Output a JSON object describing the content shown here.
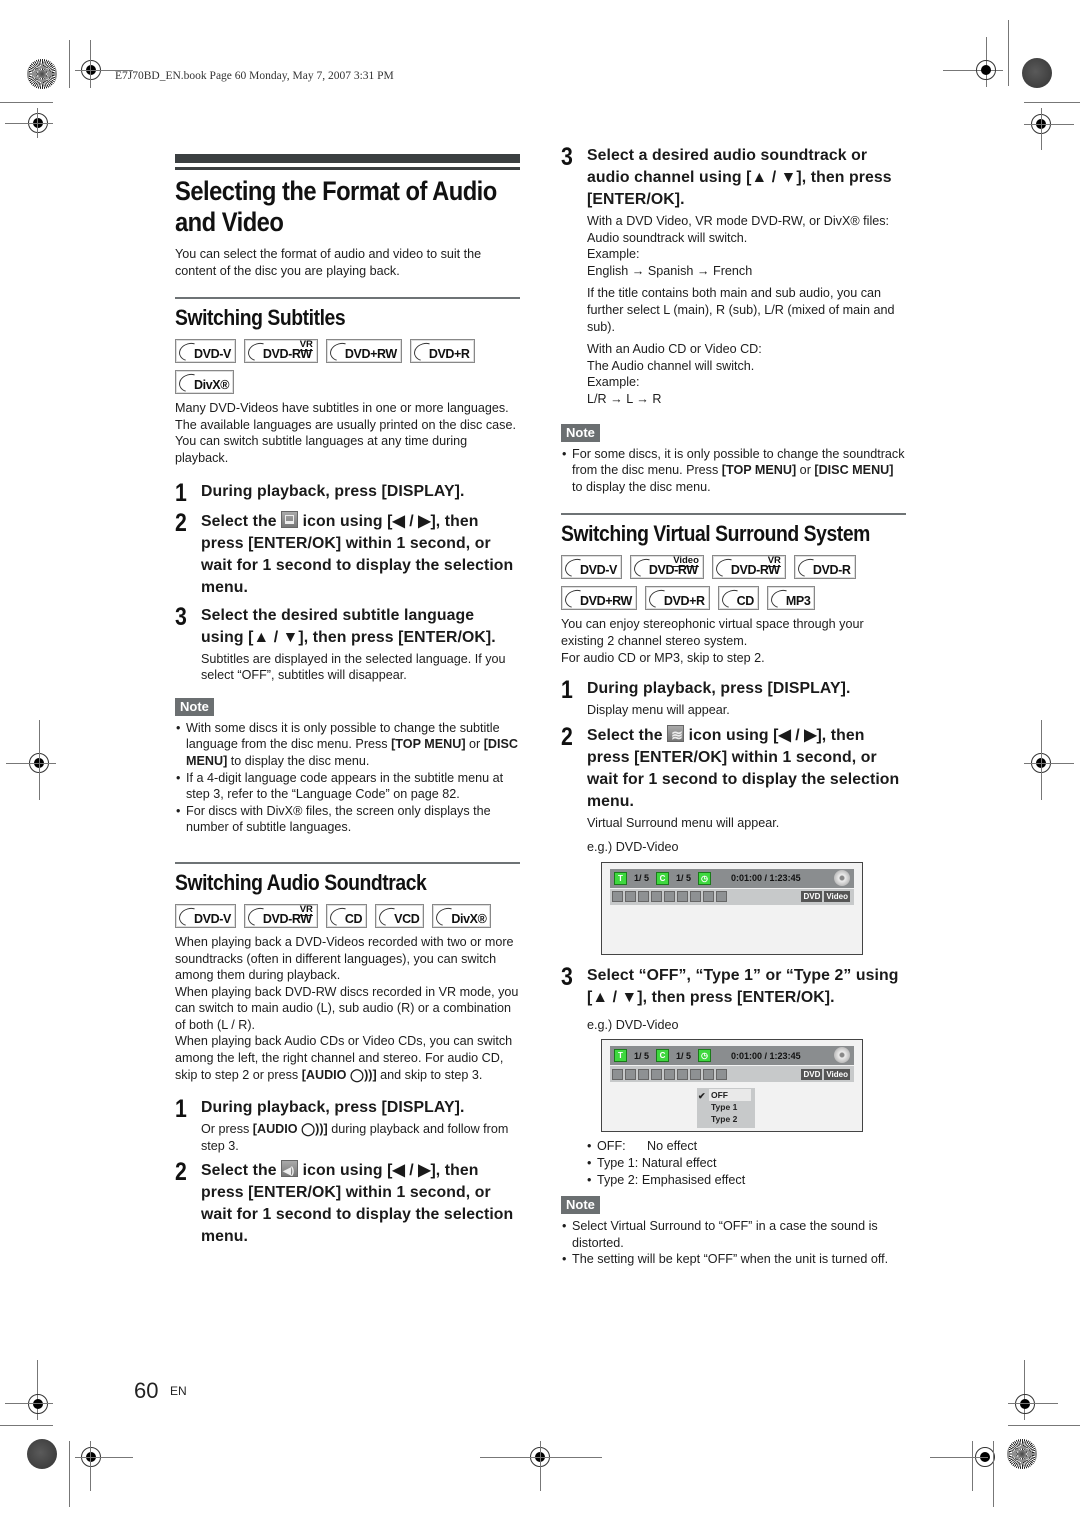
{
  "print_header": "E7J70BD_EN.book  Page 60  Monday, May 7, 2007  3:31 PM",
  "page": {
    "title": "Selecting the Format of Audio and Video",
    "intro": "You can select the format of audio and video to suit the content of the disc you are playing back.",
    "number": "60",
    "lang": "EN"
  },
  "subtitles": {
    "heading": "Switching Subtitles",
    "badges": [
      {
        "label": "DVD-V",
        "sup": ""
      },
      {
        "label": "DVD-RW",
        "sup": "VR"
      },
      {
        "label": "DVD+RW",
        "sup": ""
      },
      {
        "label": "DVD+R",
        "sup": ""
      },
      {
        "label": "DivX®",
        "sup": ""
      }
    ],
    "description": "Many DVD-Videos have subtitles in one or more languages. The available languages are usually printed on the disc case. You can switch subtitle languages at any time during playback.",
    "steps": [
      {
        "num": "1",
        "text": "During playback, press [DISPLAY].",
        "sub": ""
      },
      {
        "num": "2",
        "pre": "Select the",
        "icon": "subtitle-icon",
        "post": "icon using [◀ / ▶], then press [ENTER/OK] within 1 second, or wait for 1 second to display the selection menu.",
        "sub": ""
      },
      {
        "num": "3",
        "text": "Select the desired subtitle language using [▲ / ▼], then press [ENTER/OK].",
        "sub": "Subtitles are displayed in the selected language. If you select “OFF”, subtitles will disappear."
      }
    ],
    "note_label": "Note",
    "notes": [
      {
        "parts": [
          "With some discs it is only possible to change the subtitle language from the disc menu. Press ",
          "[TOP MENU]",
          " or ",
          "[DISC MENU]",
          " to display the disc menu."
        ]
      },
      {
        "parts": [
          "If a 4-digit language code appears in the subtitle menu at step 3, refer to the “Language Code” on page 82."
        ]
      },
      {
        "parts": [
          "For discs with DivX® files, the screen only displays the number of subtitle languages."
        ]
      }
    ]
  },
  "audio": {
    "heading": "Switching Audio Soundtrack",
    "badges": [
      {
        "label": "DVD-V",
        "sup": ""
      },
      {
        "label": "DVD-RW",
        "sup": "VR"
      },
      {
        "label": "CD",
        "sup": ""
      },
      {
        "label": "VCD",
        "sup": ""
      },
      {
        "label": "DivX®",
        "sup": ""
      }
    ],
    "description_1": "When playing back a DVD-Videos recorded with two or more soundtracks (often in different languages), you can switch among them during playback.",
    "description_2": "When playing back DVD-RW discs recorded in VR mode, you can switch to main audio (L), sub audio (R) or a combination of both (L / R).",
    "description_3_pre": "When playing back Audio CDs or Video CDs, you can switch among the left, the right channel and stereo. For audio CD, skip to step 2 or press ",
    "description_3_key": "[AUDIO ◯))]",
    "description_3_post": " and skip to step 3.",
    "steps": [
      {
        "num": "1",
        "text": "During playback, press [DISPLAY].",
        "sub_pre": "Or press ",
        "sub_key": "[AUDIO ◯))]",
        "sub_post": " during playback and follow from step 3."
      },
      {
        "num": "2",
        "pre": "Select the",
        "icon": "audio-icon",
        "post": "icon using [◀ / ▶], then press [ENTER/OK] within 1 second, or wait for 1 second to display the selection menu."
      },
      {
        "num": "3",
        "text": "Select a desired audio soundtrack or audio channel using [▲ / ▼], then press [ENTER/OK].",
        "sub_blocks": [
          "With a DVD Video, VR mode DVD-RW, or DivX® files:\nAudio soundtrack will switch.\nExample:\nEnglish → Spanish → French",
          "If the title contains both main and sub audio, you can further select L (main), R (sub), L/R (mixed of main and sub).",
          "With an Audio CD or Video CD:\nThe Audio channel will switch.\nExample:\nL/R → L → R"
        ]
      }
    ],
    "note_label": "Note",
    "notes": [
      {
        "parts": [
          "For some discs, it is only possible to change the soundtrack from the disc menu. Press ",
          "[TOP MENU]",
          " or ",
          "[DISC MENU]",
          " to display the disc menu."
        ]
      }
    ]
  },
  "surround": {
    "heading": "Switching Virtual Surround System",
    "badges": [
      {
        "label": "DVD-V",
        "sup": ""
      },
      {
        "label": "DVD-RW",
        "sup": "Video"
      },
      {
        "label": "DVD-RW",
        "sup": "VR"
      },
      {
        "label": "DVD-R",
        "sup": ""
      },
      {
        "label": "DVD+RW",
        "sup": ""
      },
      {
        "label": "DVD+R",
        "sup": ""
      },
      {
        "label": "CD",
        "sup": ""
      },
      {
        "label": "MP3",
        "sup": ""
      }
    ],
    "description": "You can enjoy stereophonic virtual space through your existing 2 channel stereo system.\nFor audio CD or MP3, skip to step 2.",
    "steps": [
      {
        "num": "1",
        "text": "During playback, press [DISPLAY].",
        "sub": "Display menu will appear."
      },
      {
        "num": "2",
        "pre": "Select the",
        "icon": "surround-icon",
        "post": "icon using [◀ / ▶], then press [ENTER/OK] within 1 second, or wait for 1 second to display the selection menu.",
        "sub": "Virtual Surround menu will appear.",
        "eg": "e.g.) DVD-Video"
      },
      {
        "num": "3",
        "text": "Select “OFF”, “Type 1” or “Type 2” using [▲ / ▼], then press [ENTER/OK].",
        "eg": "e.g.) DVD-Video"
      }
    ],
    "osd": {
      "title_label": "T",
      "title_value": "1/  5",
      "chapter_label": "C",
      "chapter_value": "1/  5",
      "time": "0:01:00 / 1:23:45",
      "tags": [
        "DVD",
        "Video"
      ],
      "menu_options": [
        "OFF",
        "Type 1",
        "Type 2"
      ],
      "menu_selected": "OFF"
    },
    "effects": [
      {
        "key": "OFF:",
        "value": "No effect"
      },
      {
        "key": "Type 1:",
        "value": "Natural effect"
      },
      {
        "key": "Type 2:",
        "value": "Emphasised effect"
      }
    ],
    "note_label": "Note",
    "notes": [
      {
        "parts": [
          "Select Virtual Surround to “OFF” in a case the sound is distorted."
        ]
      },
      {
        "parts": [
          "The setting will be kept “OFF” when the unit is turned off."
        ]
      }
    ]
  }
}
